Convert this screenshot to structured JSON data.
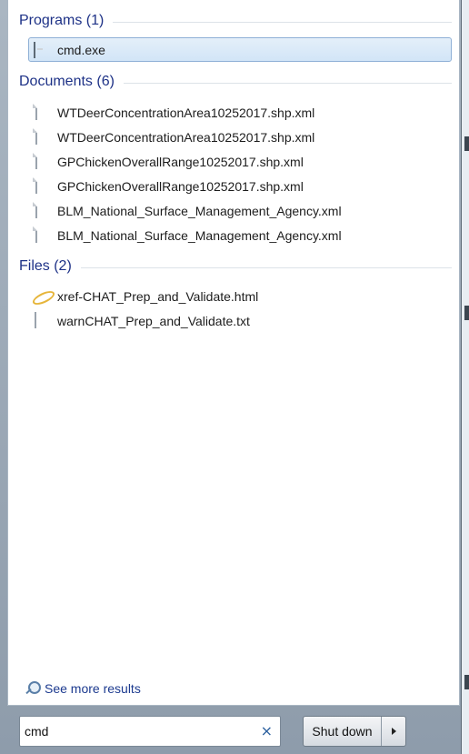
{
  "groups": {
    "programs": {
      "title": "Programs (1)",
      "items": [
        {
          "label": "cmd.exe",
          "icon": "cmd-icon"
        }
      ]
    },
    "documents": {
      "title": "Documents (6)",
      "items": [
        {
          "label": "WTDeerConcentrationArea10252017.shp.xml",
          "icon": "document-icon"
        },
        {
          "label": "WTDeerConcentrationArea10252017.shp.xml",
          "icon": "document-icon"
        },
        {
          "label": "GPChickenOverallRange10252017.shp.xml",
          "icon": "document-icon"
        },
        {
          "label": "GPChickenOverallRange10252017.shp.xml",
          "icon": "document-icon"
        },
        {
          "label": "BLM_National_Surface_Management_Agency.xml",
          "icon": "document-icon"
        },
        {
          "label": "BLM_National_Surface_Management_Agency.xml",
          "icon": "document-icon"
        }
      ]
    },
    "files": {
      "title": "Files (2)",
      "items": [
        {
          "label": "xref-CHAT_Prep_and_Validate.html",
          "icon": "html-file-icon"
        },
        {
          "label": "warnCHAT_Prep_and_Validate.txt",
          "icon": "text-file-icon"
        }
      ]
    }
  },
  "see_more": {
    "label": "See more results",
    "icon": "magnifier-icon"
  },
  "search": {
    "value": "cmd",
    "clear_icon": "×"
  },
  "shutdown": {
    "label": "Shut down",
    "arrow_icon": "triangle-right-icon"
  },
  "colors": {
    "group_title": "#1e3287",
    "selection_bg": "#d2e5f7",
    "selection_border": "#8fb0d6"
  }
}
